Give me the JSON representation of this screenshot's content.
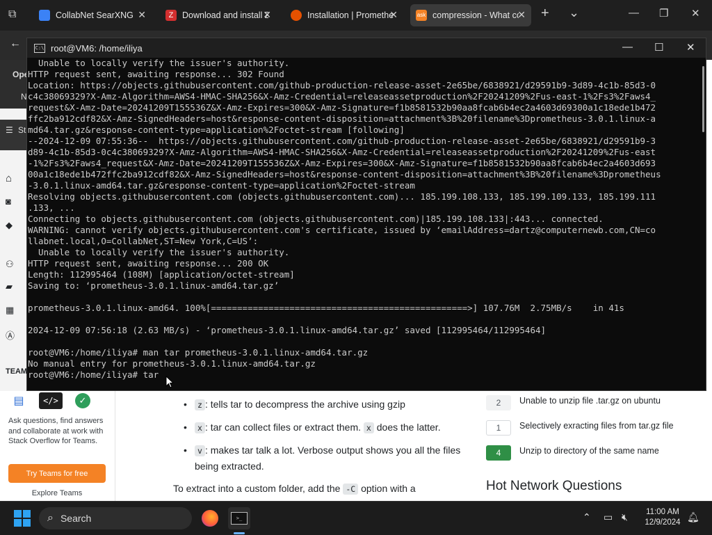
{
  "browser": {
    "tabs": [
      {
        "title": "CollabNet SearXNG",
        "color": "#3b82f6"
      },
      {
        "title": "Download and install Z",
        "color": "#d32f2f"
      },
      {
        "title": "Installation | Promethe",
        "color": "#e65100"
      },
      {
        "title": "compression - What co",
        "color": "#f48225",
        "fav_text": "ask"
      }
    ],
    "new_tab": "+",
    "tab_list": "⌄"
  },
  "terminal": {
    "title": "root@VM6: /home/iliya",
    "icon_text": "C:\\",
    "lines": [
      "  Unable to locally verify the issuer's authority.",
      "HTTP request sent, awaiting response... 302 Found",
      "Location: https://objects.githubusercontent.com/github-production-release-asset-2e65be/6838921/d29591b9-3d89-4c1b-85d3-0",
      "c4c38069329?X-Amz-Algorithm=AWS4-HMAC-SHA256&X-Amz-Credential=releaseassetproduction%2F20241209%2Fus-east-1%2Fs3%2Faws4_",
      "request&X-Amz-Date=20241209T155536Z&X-Amz-Expires=300&X-Amz-Signature=f1b8581532b90aa8fcab6b4ec2a4603d69300a1c18ede1b472",
      "ffc2ba912cdf82&X-Amz-SignedHeaders=host&response-content-disposition=attachment%3B%20filename%3Dprometheus-3.0.1.linux-a",
      "md64.tar.gz&response-content-type=application%2Foctet-stream [following]",
      "--2024-12-09 07:55:36--  https://objects.githubusercontent.com/github-production-release-asset-2e65be/6838921/d29591b9-3",
      "d89-4c1b-85d3-0c4c38069329?X-Amz-Algorithm=AWS4-HMAC-SHA256&X-Amz-Credential=releaseassetproduction%2F20241209%2Fus-east",
      "-1%2Fs3%2Faws4_request&X-Amz-Date=20241209T155536Z&X-Amz-Expires=300&X-Amz-Signature=f1b8581532b90aa8fcab6b4ec2a4603d693",
      "00a1c18ede1b472ffc2ba912cdf82&X-Amz-SignedHeaders=host&response-content-disposition=attachment%3B%20filename%3Dpromethеus",
      "-3.0.1.linux-amd64.tar.gz&response-content-type=application%2Foctet-stream",
      "Resolving objects.githubusercontent.com (objects.githubusercontent.com)... 185.199.108.133, 185.199.109.133, 185.199.111",
      ".133, ...",
      "Connecting to objects.githubusercontent.com (objects.githubusercontent.com)|185.199.108.133|:443... connected.",
      "WARNING: cannot verify objects.githubusercontent.com's certificate, issued by ‘emailAddress=dartz@computernewb.com,CN=co",
      "llabnet.local,O=CollabNet,ST=New York,C=US’:",
      "  Unable to locally verify the issuer's authority.",
      "HTTP request sent, awaiting response... 200 OK",
      "Length: 112995464 (108M) [application/octet-stream]",
      "Saving to: ‘prometheus-3.0.1.linux-amd64.tar.gz’",
      "",
      "prometheus-3.0.1.linux-amd64. 100%[=================================================>] 107.76M  2.75MB/s    in 41s",
      "",
      "2024-12-09 07:56:18 (2.63 MB/s) - ‘prometheus-3.0.1.linux-amd64.tar.gz’ saved [112995464/112995464]",
      "",
      "root@VM6:/home/iliya# man tar prometheus-3.0.1.linux-amd64.tar.gz",
      "No manual entry for prometheus-3.0.1.linux-amd64.tar.gz",
      "root@VM6:/home/iliya# tar"
    ]
  },
  "page": {
    "left_labels": [
      "Ope",
      "N",
      "Stm",
      "H",
      "Q",
      "T",
      "U",
      "J",
      "C",
      "A"
    ],
    "teams_label": "TEAM",
    "ask_text": "Ask questions, find answers and collaborate at work with Stack Overflow for Teams.",
    "teams_button": "Try Teams for free",
    "explore": "Explore Teams",
    "bullets": [
      {
        "code": "z",
        "text": ": tells tar to decompress the archive using gzip"
      },
      {
        "code": "x",
        "text": ": tar can collect files or extract them.",
        "code2": "x",
        "text2": "does the latter."
      },
      {
        "code": "v",
        "text": ": makes tar talk a lot. Verbose output shows you all the files being extracted."
      }
    ],
    "extract_text_a": "To extract into a custom folder, add the",
    "extract_code": "-C",
    "extract_text_b": "option with a",
    "related": [
      {
        "count": "2",
        "text": "Unable to unzip file .tar.gz on ubuntu",
        "answered": false
      },
      {
        "count": "1",
        "text": "Selectively exracting files from tar.gz file",
        "answered": false
      },
      {
        "count": "4",
        "text": "Unzip to directory of the same name",
        "answered": true
      }
    ],
    "hot_network": "Hot Network Questions"
  },
  "taskbar": {
    "search_label": "Search",
    "time": "11:00 AM",
    "date": "12/9/2024"
  }
}
